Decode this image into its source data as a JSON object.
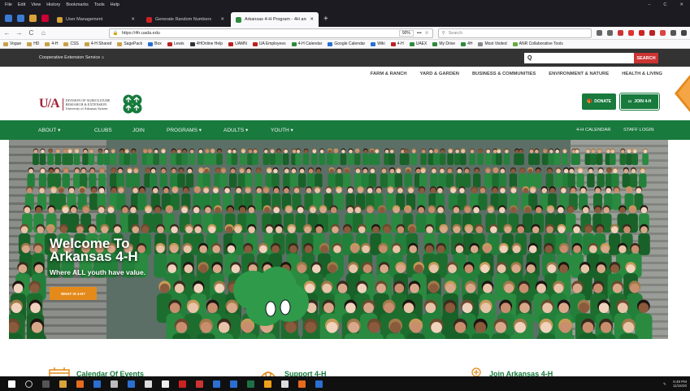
{
  "menubar": {
    "items": [
      "File",
      "Edit",
      "View",
      "History",
      "Bookmarks",
      "Tools",
      "Help"
    ],
    "window_controls": [
      "–",
      "C",
      "✕"
    ]
  },
  "tabs": [
    {
      "label": "User Management",
      "color": "#d9a23a"
    },
    {
      "label": "Generate Random Numbers",
      "color": "#cc2222"
    },
    {
      "label": "Arkansas 4-H Program - 4H and",
      "color": "#2e8b3e",
      "active": true
    }
  ],
  "tab_close": "✕",
  "new_tab": "+",
  "navbar": {
    "back": "←",
    "forward": "→",
    "reload": "C",
    "home": "⌂",
    "url": "https://4h.uada.edu",
    "zoom": "90%",
    "search_placeholder": "Search",
    "menu_dots": "•••"
  },
  "bookmarks": [
    "Vogue",
    "HD",
    "4-H",
    "CSS",
    "4-H Shared",
    "SagePack",
    "Box",
    "Lewis",
    "4HOnline Help",
    "UAMN",
    "UA Employees",
    "4-H Calendar",
    "Google Calendar",
    "Wiki",
    "4-H",
    "UAEX",
    "My Drive",
    "4H",
    "Most Visited",
    "ANR Collaborative Tools"
  ],
  "site": {
    "top_strip": "Cooperative Extension Service ⌂",
    "search_placeholder": "Q",
    "search_button": "SEARCH",
    "util_nav": [
      "FARM & RANCH",
      "YARD & GARDEN",
      "BUSINESS & COMMUNITIES",
      "ENVIRONMENT & NATURE",
      "HEALTH & LIVING"
    ],
    "logo": {
      "mark": "U/A",
      "line1": "DIVISION OF AGRICULTURE",
      "line2": "RESEARCH & EXTENSION",
      "line3": "University of Arkansas System"
    },
    "donate": "DONATE",
    "join": "JOIN 4-H",
    "main_nav": [
      "ABOUT ▾",
      "CLUBS",
      "JOIN",
      "PROGRAMS ▾",
      "ADULTS ▾",
      "YOUTH ▾"
    ],
    "main_nav_right": [
      "4-H CALENDAR",
      "STAFF LOGIN"
    ],
    "hero": {
      "title_line1": "Welcome To",
      "title_line2": "Arkansas 4-H",
      "subtitle": "Where ALL youth have value.",
      "button": "WHAT IS 4-H?"
    },
    "features": [
      {
        "label": "Calendar Of Events"
      },
      {
        "label": "Support 4-H"
      },
      {
        "label": "Join Arkansas 4-H"
      }
    ]
  },
  "taskbar": {
    "time": "5:49 PM",
    "date": "11/15/20"
  },
  "colors": {
    "green": "#187a3d",
    "red": "#cc3333",
    "orange": "#e48a1a",
    "maroon": "#9d2235"
  }
}
